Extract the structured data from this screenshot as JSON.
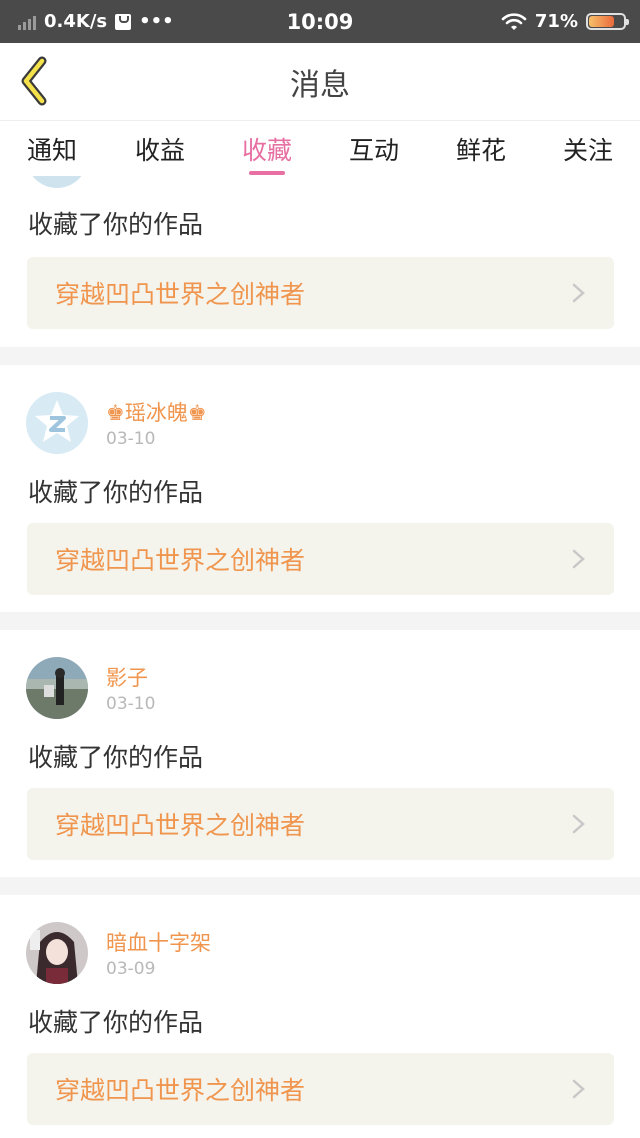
{
  "status_bar": {
    "net_speed": "0.4K/s",
    "dots": "•••",
    "time": "10:09",
    "battery": "71%"
  },
  "nav": {
    "title": "消息"
  },
  "tabs": [
    {
      "label": "通知"
    },
    {
      "label": "收益"
    },
    {
      "label": "收藏"
    },
    {
      "label": "互动"
    },
    {
      "label": "鲜花"
    },
    {
      "label": "关注"
    }
  ],
  "active_tab": "收藏",
  "colors": {
    "accent": "#e76fa2",
    "username": "#f0954e",
    "work_title": "#f0954e"
  },
  "messages": [
    {
      "username": "",
      "date": "",
      "action": "收藏了你的作品",
      "work": "穿越凹凸世界之创神者"
    },
    {
      "username": "♚瑶冰魄♚",
      "date": "03-10",
      "action": "收藏了你的作品",
      "work": "穿越凹凸世界之创神者"
    },
    {
      "username": "影子",
      "date": "03-10",
      "action": "收藏了你的作品",
      "work": "穿越凹凸世界之创神者"
    },
    {
      "username": "暗血十字架",
      "date": "03-09",
      "action": "收藏了你的作品",
      "work": "穿越凹凸世界之创神者"
    }
  ]
}
